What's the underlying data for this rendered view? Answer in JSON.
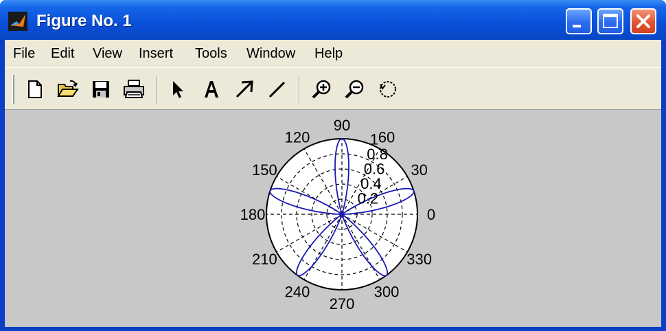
{
  "window": {
    "title": "Figure No. 1",
    "controls": [
      "minimize-icon",
      "maximize-icon",
      "close-icon"
    ]
  },
  "menu": {
    "items": [
      "File",
      "Edit",
      "View",
      "Insert",
      "Tools",
      "Window",
      "Help"
    ]
  },
  "toolbar": {
    "buttons": [
      {
        "name": "new-figure-button",
        "icon": "new-file-icon"
      },
      {
        "name": "open-file-button",
        "icon": "folder-open-icon"
      },
      {
        "name": "save-button",
        "icon": "floppy-disk-icon"
      },
      {
        "name": "print-button",
        "icon": "printer-icon"
      },
      {
        "name": "edit-plot-button",
        "icon": "arrow-cursor-icon"
      },
      {
        "name": "insert-text-button",
        "icon": "text-A-icon"
      },
      {
        "name": "insert-arrow-button",
        "icon": "arrow-icon"
      },
      {
        "name": "insert-line-button",
        "icon": "line-icon"
      },
      {
        "name": "zoom-in-button",
        "icon": "zoom-in-icon"
      },
      {
        "name": "zoom-out-button",
        "icon": "zoom-out-icon"
      },
      {
        "name": "rotate-3d-button",
        "icon": "rotate-icon"
      }
    ]
  },
  "colors": {
    "titlebar": "#0a4fd8",
    "menubar": "#ece9d8",
    "figure_background": "#c8c8c8",
    "plot_line": "#1a1ab8",
    "close_button": "#e2532f"
  },
  "chart_data": {
    "type": "polar-line",
    "function": "r = |sin(5θ/... )| rose curve, 5 petals",
    "theta_deg": [
      0,
      10,
      20,
      30,
      40,
      50,
      60,
      70,
      80,
      90,
      100,
      110,
      120,
      130,
      140,
      150,
      160,
      170,
      180,
      190,
      200,
      210,
      220,
      230,
      240,
      250,
      260,
      270,
      280,
      290,
      300,
      310,
      320,
      330,
      340,
      350,
      360
    ],
    "r_petals": {
      "petal_count": 5,
      "petal_angles_deg": [
        18,
        90,
        162,
        234,
        306
      ],
      "max_r": 1
    },
    "angle_tick_labels": [
      "0",
      "30",
      "60",
      "90",
      "120",
      "150",
      "180",
      "210",
      "240",
      "270",
      "300",
      "330"
    ],
    "radial_tick_labels": [
      "0.2",
      "0.4",
      "0.6",
      "0.8",
      "1"
    ],
    "rlim": [
      0,
      1
    ],
    "grid": true,
    "line_color": "#1a1ab8"
  }
}
